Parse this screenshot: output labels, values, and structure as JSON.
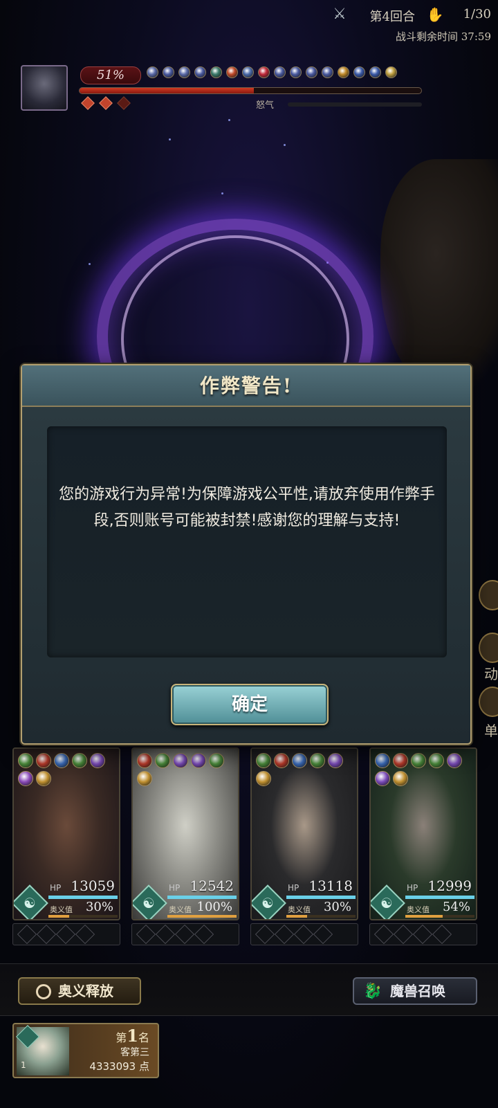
{
  "hud": {
    "round": "第4回合",
    "turns": "1/30",
    "timer": "战斗剩余时间 37:59",
    "round_icon": "crossed-swords-icon",
    "turns_icon": "footprint-icon"
  },
  "boss": {
    "hp_percent": "51%",
    "hp_fraction": 0.51,
    "rage_label": "怒气",
    "rage_fraction": 0.0,
    "buff_colors": [
      "#5a6aa8",
      "#4a5aa0",
      "#5a6aa8",
      "#4a5aa0",
      "#3a7a6a",
      "#c04a2a",
      "#4a6aa8",
      "#c02a3a",
      "#4a5aa0",
      "#4a5aa0",
      "#4a5aa0",
      "#4a5aa0",
      "#c08a2a",
      "#3a5aa8",
      "#3a5aa8",
      "#c0a040"
    ],
    "rage_gems": [
      true,
      true,
      false
    ]
  },
  "dialog": {
    "title": "作弊警告!",
    "message": "您的游戏行为异常!为保障游戏公平性,请放弃使用作弊手段,否则账号可能被封禁!感谢您的理解与支持!",
    "confirm": "确定"
  },
  "side_buttons": {
    "text1": "动",
    "text2": "单"
  },
  "cards": [
    {
      "hp_label": "HP",
      "hp": "13059",
      "ougi_label": "奥义值",
      "ougi": "30%",
      "ougi_fraction": 0.3,
      "hp_fraction": 1.0,
      "elements": [
        "#4a8a3a",
        "#b83a2a",
        "#3a6ab8",
        "#4a8a3a",
        "#7a4ab8",
        "#8a4ab8",
        "#c09030"
      ],
      "art": [
        "#3a2a24",
        "#6a4a3a",
        "#1a1418"
      ]
    },
    {
      "hp_label": "HP",
      "hp": "12542",
      "ougi_label": "奥义值",
      "ougi": "100%",
      "ougi_fraction": 1.0,
      "hp_fraction": 1.0,
      "elements": [
        "#b83a2a",
        "#4a8a3a",
        "#7a4ab8",
        "#7a4ab8",
        "#4a8a3a",
        "#c09030"
      ],
      "art": [
        "#8a8a84",
        "#cfcfc6",
        "#3a3a38"
      ]
    },
    {
      "hp_label": "HP",
      "hp": "13118",
      "ougi_label": "奥义值",
      "ougi": "30%",
      "ougi_fraction": 0.3,
      "hp_fraction": 1.0,
      "elements": [
        "#4a8a3a",
        "#b83a2a",
        "#3a6ab8",
        "#4a8a3a",
        "#7a4ab8",
        "#c09030"
      ],
      "art": [
        "#2a2a2c",
        "#a89888",
        "#1a1a1c"
      ]
    },
    {
      "hp_label": "HP",
      "hp": "12999",
      "ougi_label": "奥义值",
      "ougi": "54%",
      "ougi_fraction": 0.54,
      "hp_fraction": 1.0,
      "elements": [
        "#3a6ab8",
        "#b83a2a",
        "#4a8a3a",
        "#4a8a3a",
        "#7a4ab8",
        "#7a4ab8",
        "#c09030"
      ],
      "art": [
        "#2a3a2a",
        "#8a8078",
        "#14201a"
      ]
    }
  ],
  "bottom": {
    "ougi_button": "奥义释放",
    "summon_button": "魔兽召唤"
  },
  "rank": {
    "position_prefix": "第",
    "position": "1",
    "position_suffix": "名",
    "name": "客第三",
    "score": "4333093 点",
    "index": "1"
  }
}
